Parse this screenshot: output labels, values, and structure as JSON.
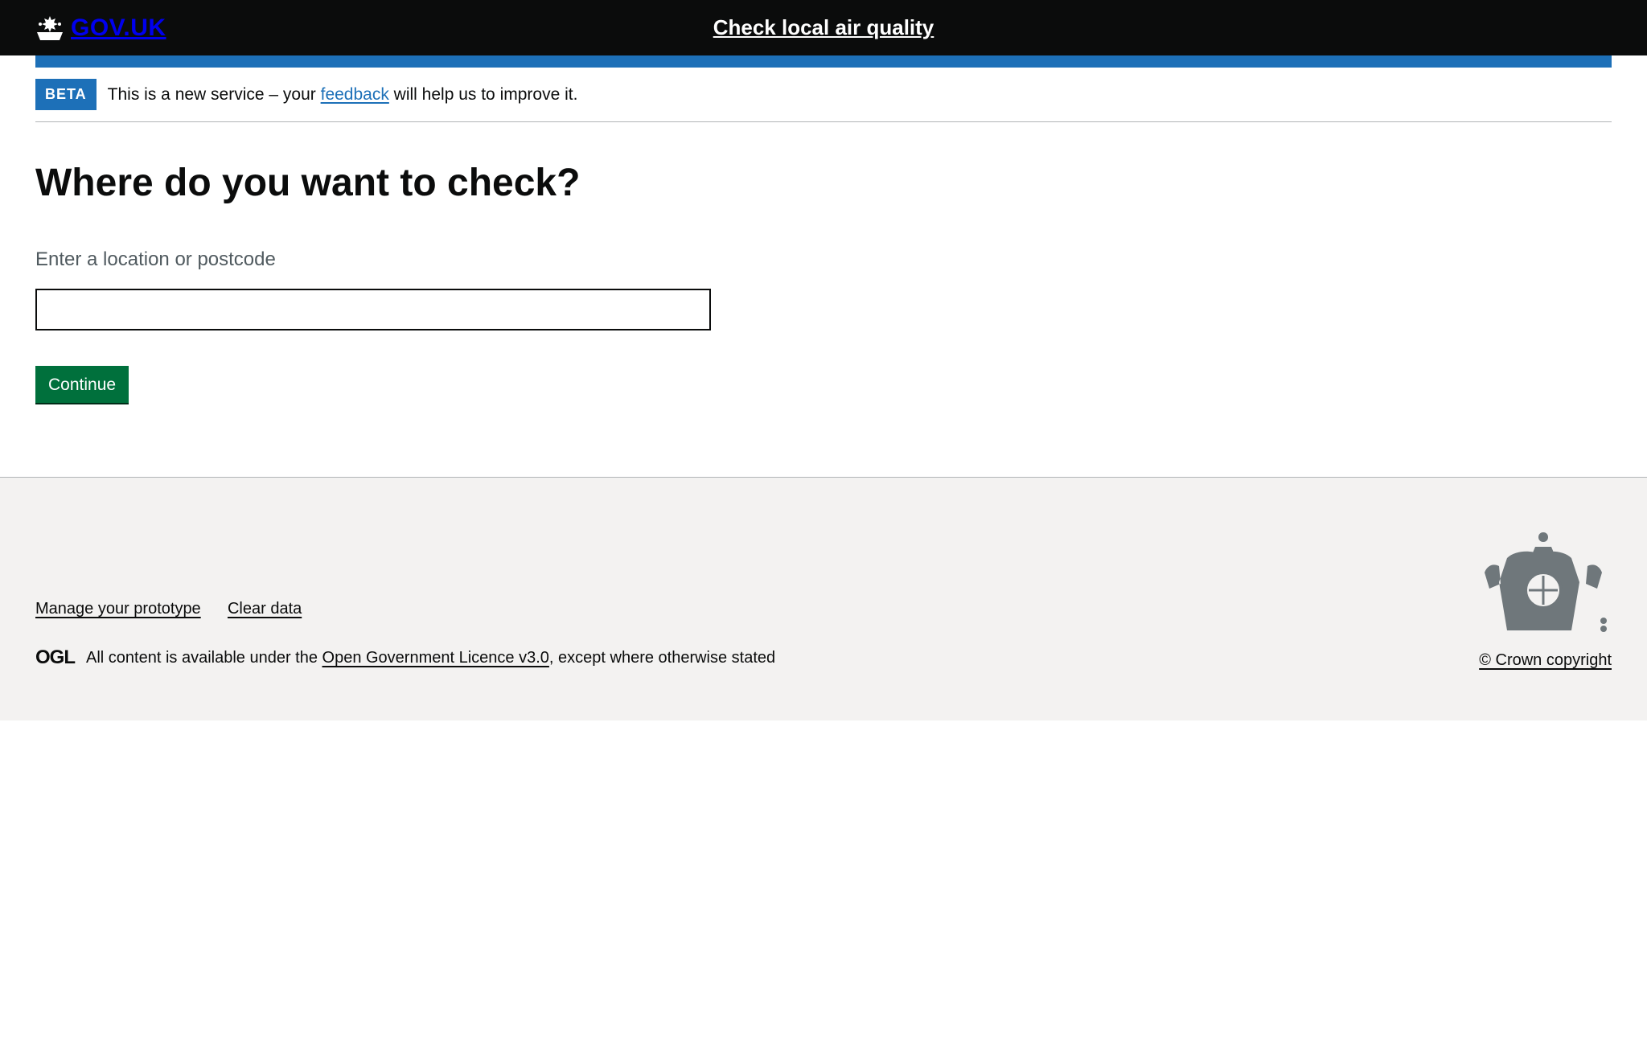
{
  "header": {
    "logo_text": "GOV.UK",
    "service_name": "Check local air quality"
  },
  "phase_banner": {
    "tag": "BETA",
    "text_before": "This is a new service – your ",
    "link_text": "feedback",
    "text_after": " will help us to improve it."
  },
  "main": {
    "heading": "Where do you want to check?",
    "label": "Enter a location or postcode",
    "input_value": "",
    "button": "Continue"
  },
  "footer": {
    "links": [
      "Manage your prototype",
      "Clear data"
    ],
    "ogl": "OGL",
    "licence_before": "All content is available under the ",
    "licence_link": "Open Government Licence v3.0",
    "licence_after": ", except where otherwise stated",
    "crown": "© Crown copyright"
  }
}
